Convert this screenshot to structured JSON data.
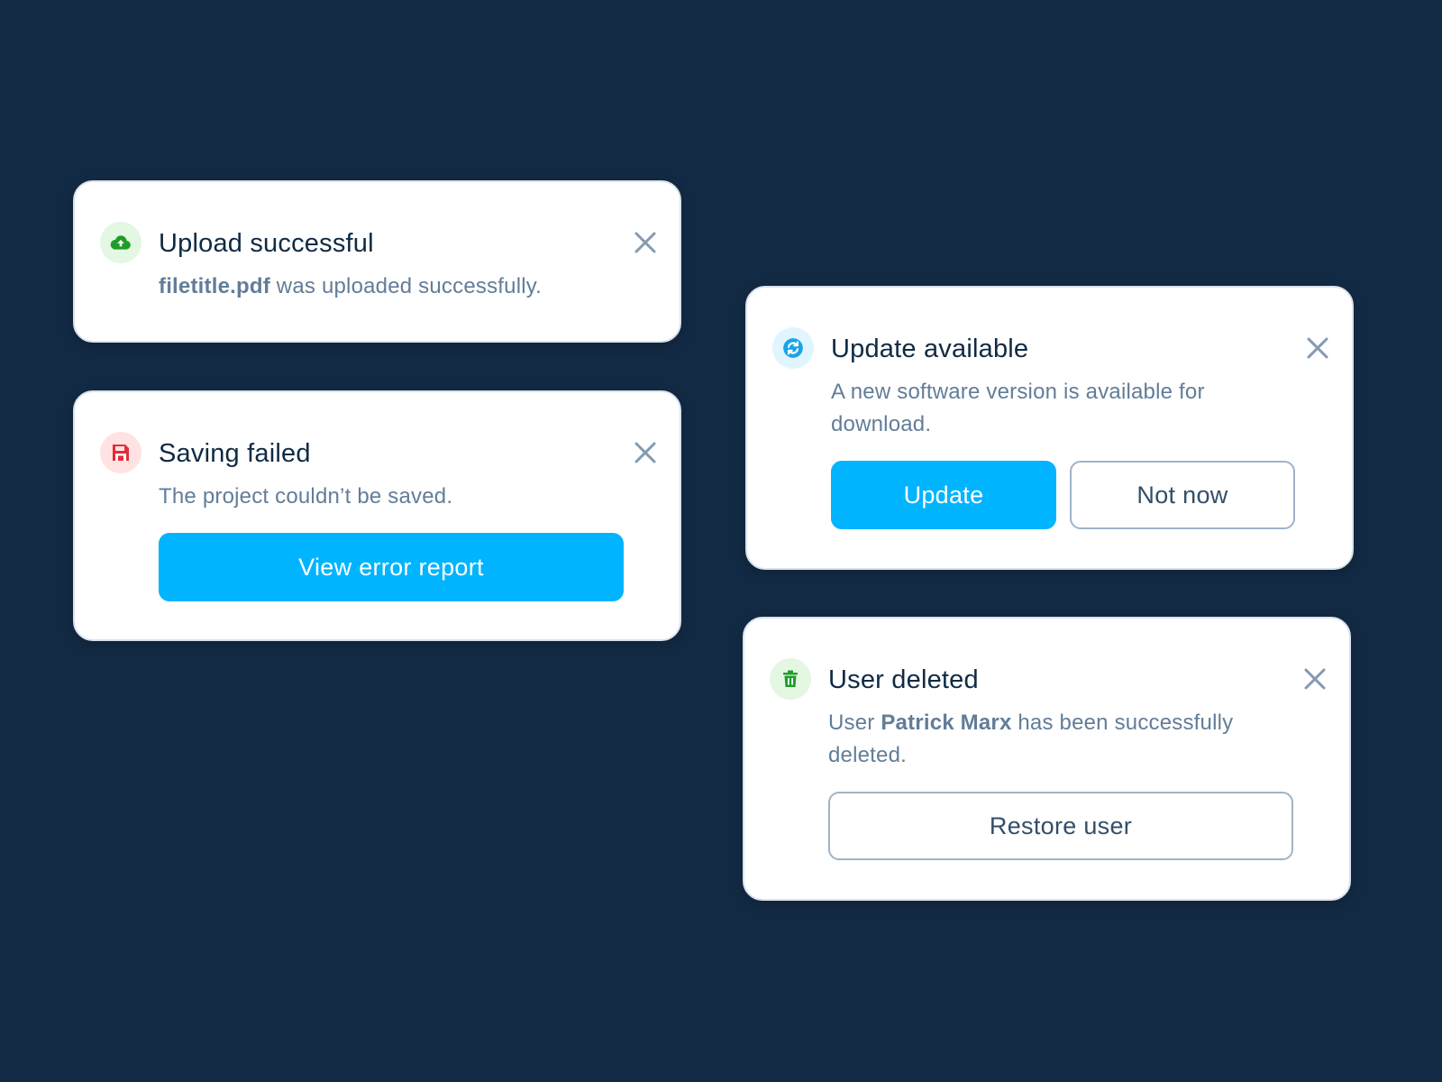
{
  "toasts": {
    "upload": {
      "title": "Upload successful",
      "message_strong": "filetitle.pdf",
      "message_rest": " was uploaded successfully.",
      "icon": "cloud-upload-icon",
      "icon_color": "#1f9d2a",
      "icon_bg": "#e3f7e3"
    },
    "saving": {
      "title": "Saving failed",
      "message": "The project couldn’t be saved.",
      "button_label": "View error report",
      "icon": "save-icon",
      "icon_color": "#e12d39",
      "icon_bg": "#ffe3e3"
    },
    "update": {
      "title": "Update available",
      "message": "A new software version is available for download.",
      "primary_label": "Update",
      "secondary_label": "Not now",
      "icon": "refresh-icon",
      "icon_color": "#1aa3e8",
      "icon_bg": "#e1f5fe"
    },
    "deleted": {
      "title": "User deleted",
      "message_prefix": "User ",
      "message_strong": "Patrick Marx",
      "message_suffix": " has been successfully deleted.",
      "button_label": "Restore user",
      "icon": "trash-icon",
      "icon_color": "#1f9d2a",
      "icon_bg": "#e3f7e3"
    }
  },
  "colors": {
    "background": "#132a44",
    "primary": "#00b4ff",
    "title_text": "#102a43",
    "body_text": "#627d98",
    "close_icon": "#829ab1"
  }
}
